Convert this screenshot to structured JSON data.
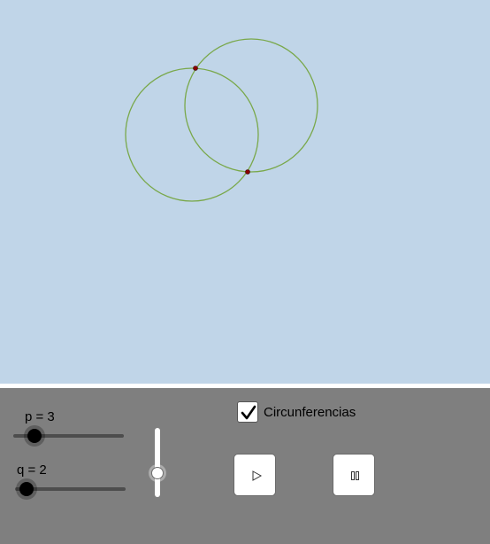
{
  "canvas": {
    "background": "#c0d5e8",
    "circle_color": "#79a84a",
    "point_color": "#8b0000"
  },
  "panel": {
    "background": "#7f7f7f",
    "slider_p": {
      "label": "p = 3",
      "value": 3
    },
    "slider_q": {
      "label": "q = 2",
      "value": 2
    },
    "checkbox": {
      "label": "Circunferencias",
      "checked": true
    },
    "play_icon": "play-icon",
    "pause_icon": "pause-icon"
  }
}
